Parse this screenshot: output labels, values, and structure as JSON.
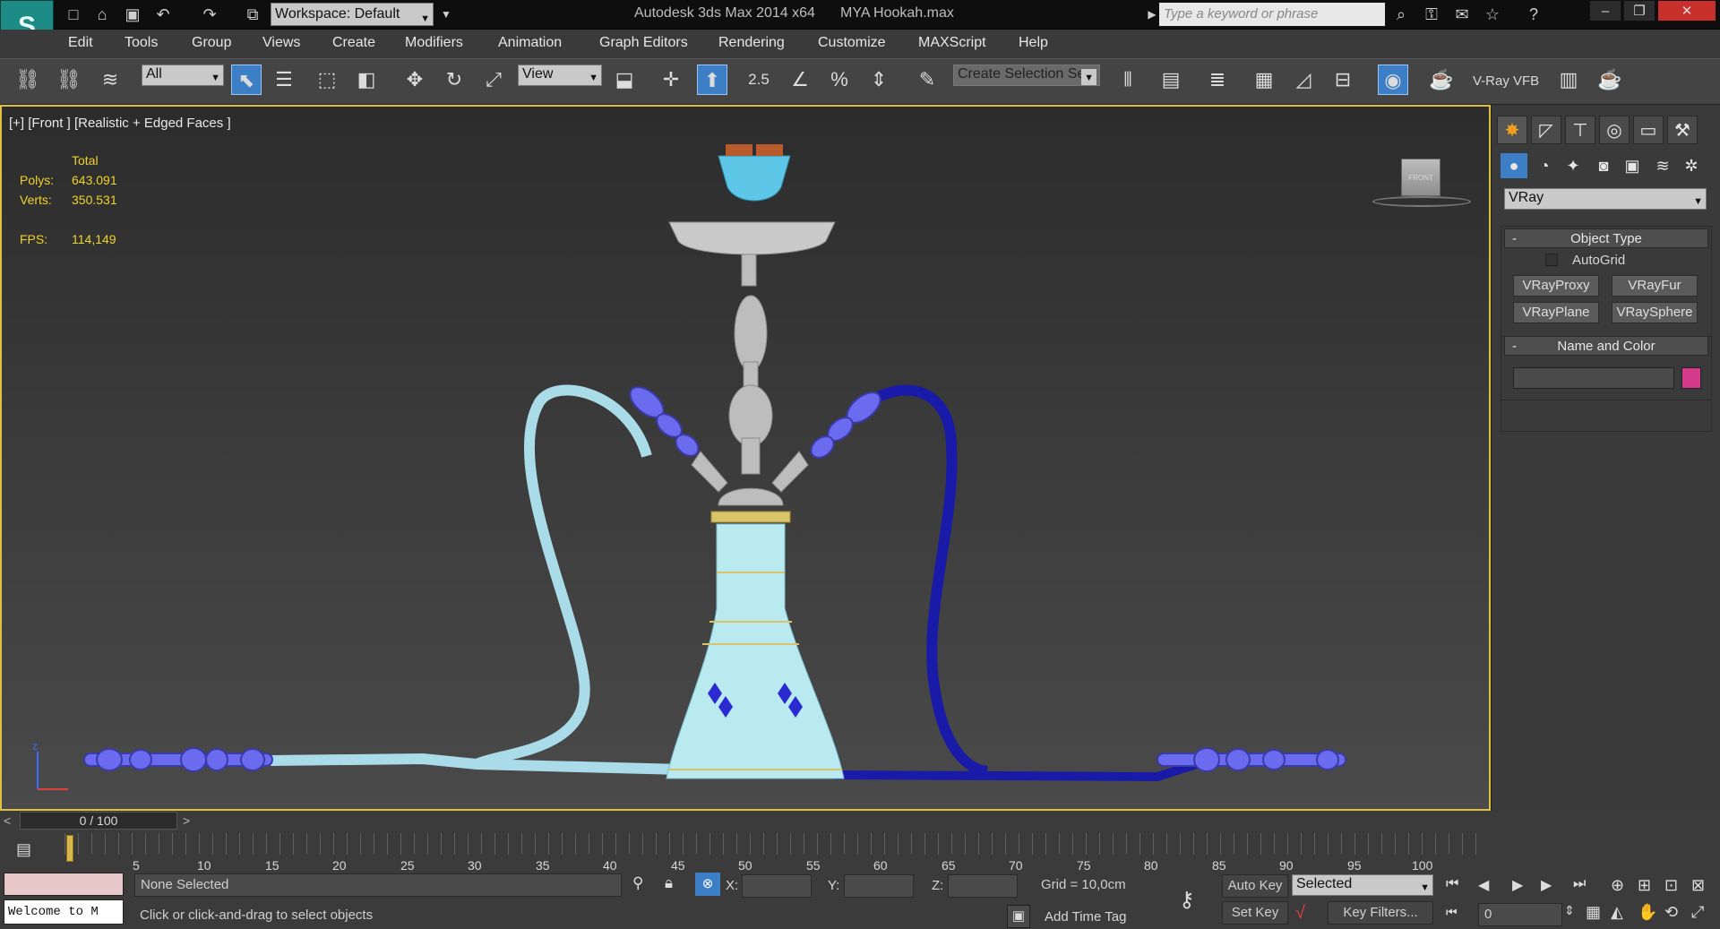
{
  "titlebar": {
    "workspace_label": "Workspace: Default",
    "app_title": "Autodesk 3ds Max  2014 x64",
    "file_name": "MYA Hookah.max",
    "search_placeholder": "Type a keyword or phrase"
  },
  "menu": [
    "Edit",
    "Tools",
    "Group",
    "Views",
    "Create",
    "Modifiers",
    "Animation",
    "Graph Editors",
    "Rendering",
    "Customize",
    "MAXScript",
    "Help"
  ],
  "toolbar": {
    "filter_value": "All",
    "ref_coord_value": "View",
    "snap_label": "2.5",
    "selection_set_placeholder": "Create Selection Se",
    "vray_vfb_label": "V-Ray VFB"
  },
  "viewport": {
    "label": "[+] [Front ] [Realistic + Edged Faces ]",
    "stats": {
      "total_label": "Total",
      "polys_label": "Polys:",
      "polys_value": "643.091",
      "verts_label": "Verts:",
      "verts_value": "350.531",
      "fps_label": "FPS:",
      "fps_value": "114,149"
    },
    "viewcube_label": "FRONT"
  },
  "command_panel": {
    "category_value": "VRay",
    "object_type_header": "Object Type",
    "autogrid_label": "AutoGrid",
    "buttons": [
      "VRayProxy",
      "VRayFur",
      "VRayPlane",
      "VRaySphere"
    ],
    "name_color_header": "Name and Color",
    "color_swatch": "#d43a8c"
  },
  "timeline": {
    "frame_display": "0 / 100",
    "ticks": [
      "5",
      "10",
      "15",
      "20",
      "25",
      "30",
      "35",
      "40",
      "45",
      "50",
      "55",
      "60",
      "65",
      "70",
      "75",
      "80",
      "85",
      "90",
      "95",
      "100"
    ]
  },
  "status": {
    "maxscript_text": "Welcome to M",
    "selection_text": "None Selected",
    "prompt_text": "Click or click-and-drag to select objects",
    "x_label": "X:",
    "y_label": "Y:",
    "z_label": "Z:",
    "grid_text": "Grid = 10,0cm",
    "add_time_tag": "Add Time Tag",
    "auto_key": "Auto Key",
    "key_mode_value": "Selected",
    "set_key": "Set Key",
    "key_filters": "Key Filters...",
    "frame_value": "0"
  },
  "colors": {
    "accent": "#3d7fc7",
    "hose_light": "#a9dbe8",
    "hose_dark": "#1a1aa8",
    "vase": "#b8eaf0",
    "stem": "#bdbdbd"
  }
}
